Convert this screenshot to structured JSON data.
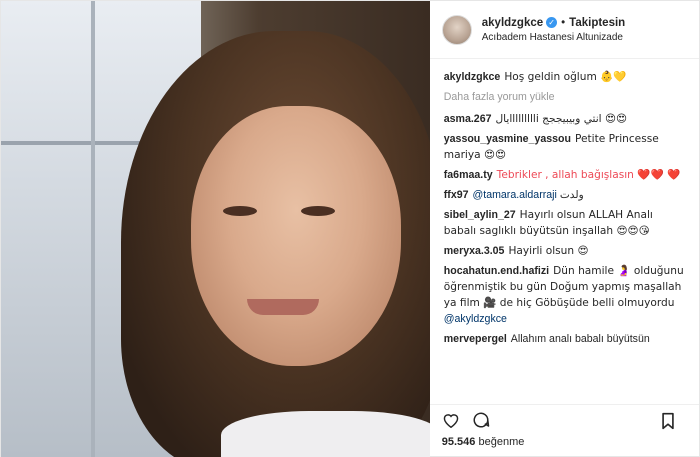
{
  "header": {
    "username": "akyldzgkce",
    "dot": "•",
    "follow_label": "Takiptesin",
    "location": "Acıbadem Hastanesi Altunizade"
  },
  "caption": {
    "user": "akyldzgkce",
    "text": "Hoş geldin oğlum 👶💛"
  },
  "load_more": "Daha fazla yorum yükle",
  "comments": [
    {
      "user": "asma.267",
      "text": "يالllllllllli انتي وبيبيججج 😍😍"
    },
    {
      "user": "yassou_yasmine_yassou",
      "text": "Petite Princesse mariya 😍😍"
    },
    {
      "user": "fa6maa.ty",
      "text": "Tebrikler , allah bağışlasın ❤️❤️ ❤️"
    },
    {
      "user": "ffx97",
      "mention": "@tamara.aldarraji",
      "text": " ولدت"
    },
    {
      "user": "sibel_aylin_27",
      "text": "Hayırlı olsun ALLAH Analı babalı saglıklı büyütsün inşallah 😍😍😘"
    },
    {
      "user": "meryxa.3.05",
      "text": "Hayirli olsun 😍"
    },
    {
      "user": "hocahatun.end.hafizi",
      "text": "Dün hamile 🤰 olduğunu öğrenmiştik bu gün Doğum yapmış maşallah ya film 🎥 de hiç Göbüşüde belli olmuyordu",
      "mention": "@akyldzgkce"
    },
    {
      "user": "mervepergel",
      "text": "Allahım analı babalı büyütsün"
    }
  ],
  "likes": {
    "count": "95.546",
    "label": "beğenme"
  },
  "colors": {
    "link": "#003569",
    "verified": "#3897f0",
    "heart": "#ed4956"
  }
}
